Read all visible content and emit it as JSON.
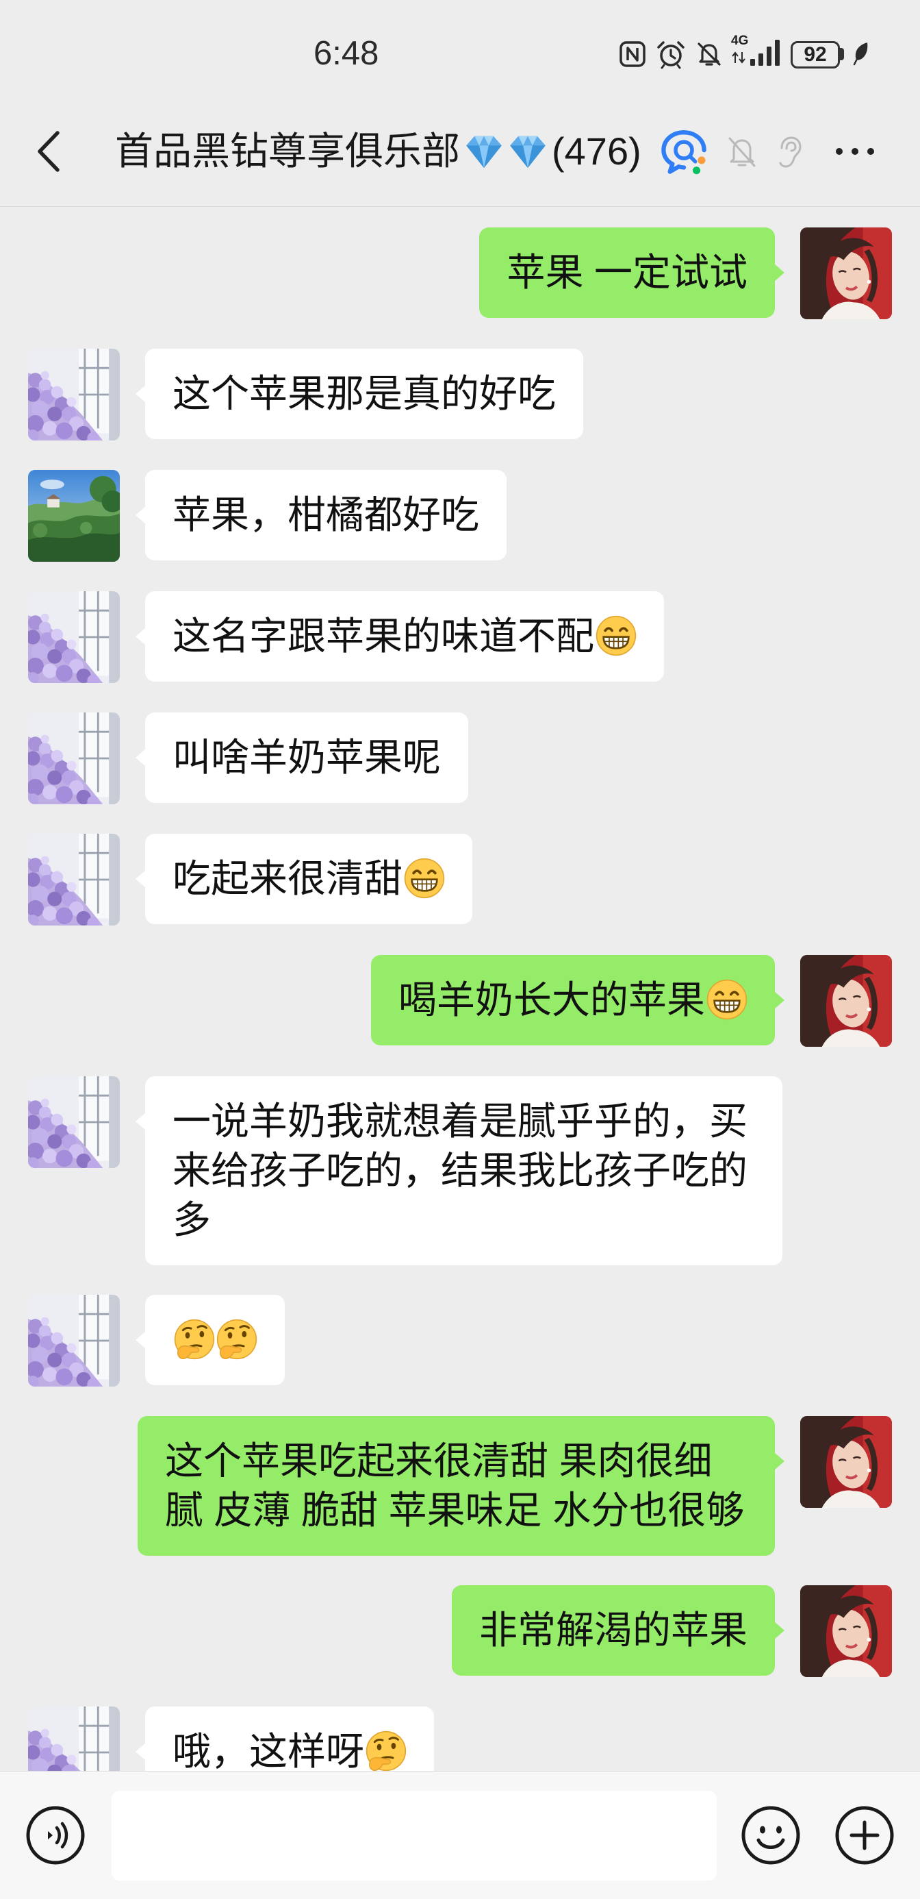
{
  "status_bar": {
    "time": "6:48",
    "network": "4G",
    "battery": "92",
    "icons": [
      "nfc-icon",
      "alarm-icon",
      "notifications-off-icon",
      "signal-icon",
      "battery-icon",
      "leaf-icon"
    ]
  },
  "header": {
    "title": "首品黑钻尊享俱乐部",
    "title_emoji": [
      "gem-stone",
      "gem-stone"
    ],
    "member_count": "(476)",
    "icons": [
      "back-icon",
      "chat-search-icon",
      "mute-icon",
      "ear-icon",
      "more-icon"
    ]
  },
  "messages": [
    {
      "side": "right",
      "avatar": "self-photo",
      "text": "苹果 一定试试"
    },
    {
      "side": "left",
      "avatar": "purple-flowers",
      "text": "这个苹果那是真的好吃"
    },
    {
      "side": "left",
      "avatar": "landscape",
      "text": "苹果，柑橘都好吃"
    },
    {
      "side": "left",
      "avatar": "purple-flowers",
      "text": "这名字跟苹果的味道不配",
      "emoji": [
        "grinning-face"
      ]
    },
    {
      "side": "left",
      "avatar": "purple-flowers",
      "text": "叫啥羊奶苹果呢"
    },
    {
      "side": "left",
      "avatar": "purple-flowers",
      "text": "吃起来很清甜",
      "emoji": [
        "grinning-face"
      ]
    },
    {
      "side": "right",
      "avatar": "self-photo",
      "text": "喝羊奶长大的苹果",
      "emoji": [
        "grinning-face"
      ]
    },
    {
      "side": "left",
      "avatar": "purple-flowers",
      "text": "一说羊奶我就想着是腻乎乎的，买来给孩子吃的，结果我比孩子吃的多"
    },
    {
      "side": "left",
      "avatar": "purple-flowers",
      "emoji": [
        "thinking-face",
        "thinking-face"
      ]
    },
    {
      "side": "right",
      "avatar": "self-photo",
      "text": "这个苹果吃起来很清甜 果肉很细腻 皮薄 脆甜 苹果味足 水分也很够"
    },
    {
      "side": "right",
      "avatar": "self-photo",
      "text": "非常解渴的苹果"
    },
    {
      "side": "left",
      "avatar": "purple-flowers",
      "text": "哦，这样呀",
      "emoji": [
        "thinking-face"
      ]
    }
  ],
  "composer": {
    "icons": [
      "voice-icon",
      "emoji-icon",
      "plus-icon"
    ]
  },
  "colors": {
    "background": "#ededed",
    "self_bubble": "#95ec69",
    "other_bubble": "#ffffff",
    "bottom_bar": "#f7f7f7",
    "accent_blue": "#2f7ef6"
  }
}
